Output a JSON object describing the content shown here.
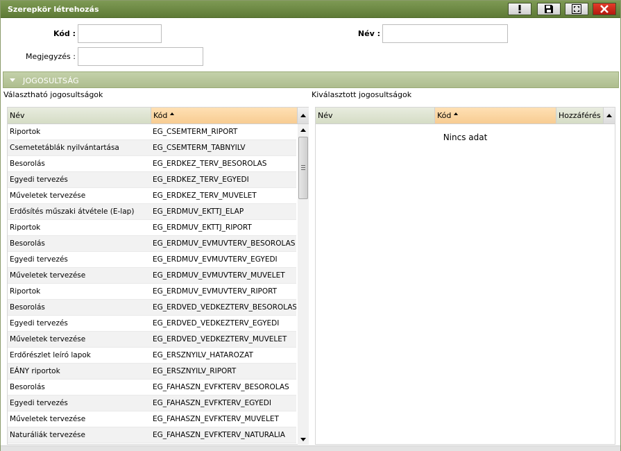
{
  "window": {
    "title": "Szerepkör létrehozás",
    "buttons": [
      "alert-icon",
      "save-icon",
      "maximize-icon",
      "close-icon"
    ]
  },
  "form": {
    "kod_label": "Kód :",
    "kod_value": "",
    "nev_label": "Név :",
    "nev_value": "",
    "megjegyzes_label": "Megjegyzés :",
    "megjegyzes_value": ""
  },
  "section": {
    "title": "JOGOSULTSÁG"
  },
  "available": {
    "label": "Választható jogosultságok",
    "columns": [
      "Név",
      "Kód"
    ],
    "sorted_column": "Kód",
    "rows": [
      [
        "Riportok",
        "EG_CSEMTERM_RIPORT"
      ],
      [
        "Csemetetáblák nyilvántartása",
        "EG_CSEMTERM_TABNYILV"
      ],
      [
        "Besorolás",
        "EG_ERDKEZ_TERV_BESOROLAS"
      ],
      [
        "Egyedi tervezés",
        "EG_ERDKEZ_TERV_EGYEDI"
      ],
      [
        "Műveletek tervezése",
        "EG_ERDKEZ_TERV_MUVELET"
      ],
      [
        "Erdősítés műszaki átvétele (E-lap)",
        "EG_ERDMUV_EKTTJ_ELAP"
      ],
      [
        "Riportok",
        "EG_ERDMUV_EKTTJ_RIPORT"
      ],
      [
        "Besorolás",
        "EG_ERDMUV_EVMUVTERV_BESOROLAS"
      ],
      [
        "Egyedi tervezés",
        "EG_ERDMUV_EVMUVTERV_EGYEDI"
      ],
      [
        "Műveletek tervezése",
        "EG_ERDMUV_EVMUVTERV_MUVELET"
      ],
      [
        "Riportok",
        "EG_ERDMUV_EVMUVTERV_RIPORT"
      ],
      [
        "Besorolás",
        "EG_ERDVED_VEDKEZTERV_BESOROLAS"
      ],
      [
        "Egyedi tervezés",
        "EG_ERDVED_VEDKEZTERV_EGYEDI"
      ],
      [
        "Műveletek tervezése",
        "EG_ERDVED_VEDKEZTERV_MUVELET"
      ],
      [
        "Erdőrészlet leíró lapok",
        "EG_ERSZNYILV_HATAROZAT"
      ],
      [
        "EÁNY riportok",
        "EG_ERSZNYILV_RIPORT"
      ],
      [
        "Besorolás",
        "EG_FAHASZN_EVFKTERV_BESOROLAS"
      ],
      [
        "Egyedi tervezés",
        "EG_FAHASZN_EVFKTERV_EGYEDI"
      ],
      [
        "Műveletek tervezése",
        "EG_FAHASZN_EVFKTERV_MUVELET"
      ],
      [
        "Naturáliák tervezése",
        "EG_FAHASZN_EVFKTERV_NATURALIA"
      ]
    ]
  },
  "selected": {
    "label": "Kiválasztott jogosultságok",
    "columns": [
      "Név",
      "Kód",
      "Hozzáférés"
    ],
    "sorted_column": "Kód",
    "empty_text": "Nincs adat"
  },
  "colors": {
    "titlebar": "#6e8a45",
    "section": "#b8c79b",
    "sorted_header": "#f9d4a0",
    "close_button": "#c8241a"
  }
}
